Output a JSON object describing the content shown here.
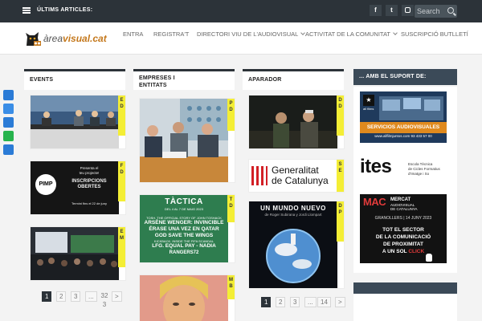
{
  "topbar": {
    "ticker_label": "ÚLTIMS ARTICLES:",
    "social": [
      "f",
      "t",
      "ig"
    ],
    "search_placeholder": "Search"
  },
  "header": {
    "logo_prefix": "àrea",
    "logo_name": "visual.cat",
    "nav": [
      {
        "label": "ENTRA",
        "dropdown": false
      },
      {
        "label": "REGISTRA'T",
        "dropdown": false
      },
      {
        "label": "DIRECTORI VIU DE L'AUDIOVISUAL",
        "dropdown": true
      },
      {
        "label": "ACTIVITAT DE LA COMUNITAT",
        "dropdown": true
      },
      {
        "label": "SUSCRIPCIÓ BUTLLETÍ",
        "dropdown": false
      }
    ]
  },
  "share_colors": [
    "#2b7bd6",
    "#3a8de6",
    "#2b7bd6",
    "#27b34d",
    "#2b7bd6"
  ],
  "columns": {
    "events": {
      "title": "EVENTS",
      "tags": [
        "E D",
        "F D",
        "E M"
      ],
      "poster": {
        "logo": "PIMP",
        "line1": "Presenta el",
        "line2": "teu projecte!",
        "headline1": "INSCRIPCIONS",
        "headline2": "OBERTES",
        "small": "Termini fins el 22 de juny"
      },
      "pager": [
        "1",
        "2",
        "3",
        "...",
        "32 3",
        ">"
      ]
    },
    "empreses": {
      "title_line1": "EMPRESES I",
      "title_line2": "ENTITATS",
      "tags": [
        "P D",
        "T D",
        "M B"
      ],
      "poster": {
        "title": "TÀCTICA",
        "date": "DEL 4 AL 7 DE MAIG 2023",
        "line1": "TOSH. THE OFFICIAL STORY OF JOHN TOSHACK",
        "line2": "ARSÈNE WENGER: INVINCIBLE",
        "line3": "ÉRASE UNA VEZ EN QATAR",
        "line4": "GOD SAVE THE WINGS",
        "line5": "KICKBACK. INSIDE THE FIFA SCANDAL",
        "line6": "LFG. EQUAL PAY - NADIA",
        "line7": "RANGERS72"
      }
    },
    "aparador": {
      "title": "APARADOR",
      "tags": [
        "D D",
        "S E",
        "D P"
      ],
      "generalitat_line1": "Generalitat",
      "generalitat_line2": "de Catalunya",
      "movie_title": "UN MUNDO NUEVO",
      "movie_credit": "de Roger Subirana y Jordi Llompart",
      "pager": [
        "1",
        "2",
        "3",
        "...",
        "14",
        ">"
      ]
    }
  },
  "sidebar": {
    "title": "... AMB EL SUPORT DE:",
    "ad1": {
      "brand": "all films",
      "line1": "SERVICIOS AUDIOVISUALES",
      "line2": "www.allfilmjuntos.com  93 433 57 00"
    },
    "ad2": {
      "name": "ites",
      "line1": "Escola Tècnica",
      "line2": "de Cicles Formatius",
      "line3": "d'Imatge i So"
    },
    "ad3": {
      "mac": "MAC",
      "mercat1": "MERCAT",
      "mercat2": "AUDIOVISUAL",
      "mercat3": "DE CATALUNYA",
      "place": "GRANOLLERS | 14 JUNY 2023",
      "l1": "TOT EL SECTOR",
      "l2": "DE LA COMUNICACIÓ",
      "l3": "DE PROXIMITAT",
      "l4a": "A UN SOL ",
      "l4b": "CLICK"
    }
  }
}
